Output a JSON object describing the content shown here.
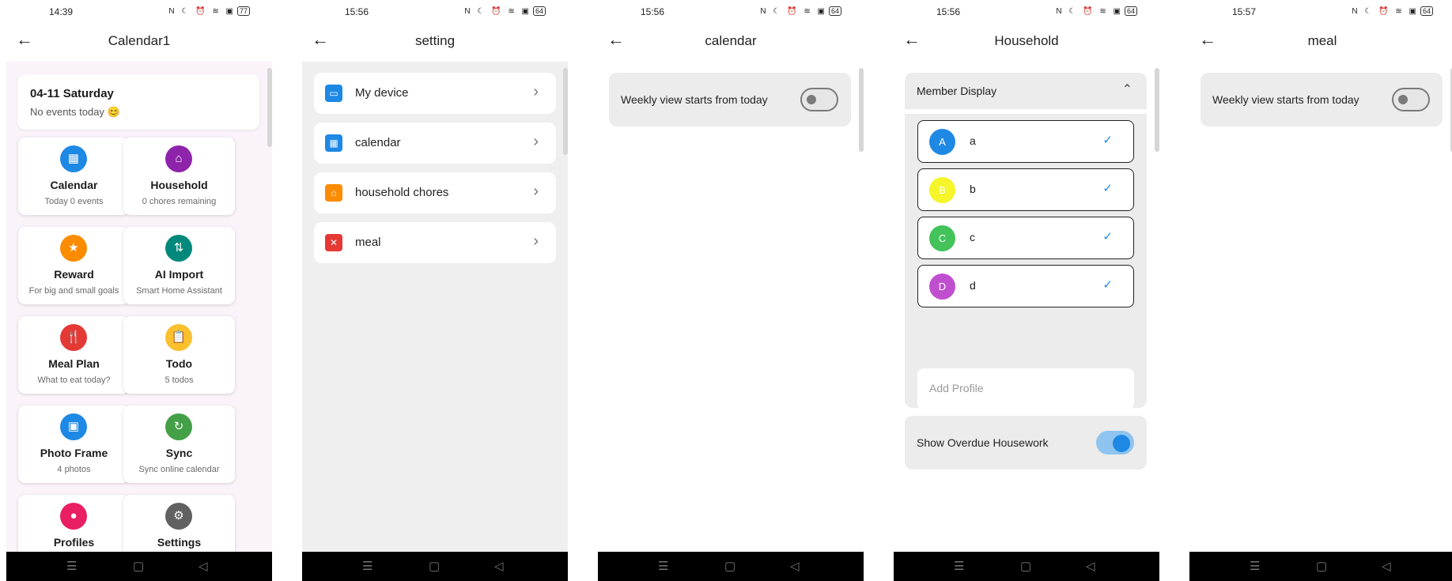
{
  "nav_glyphs": {
    "back": "←",
    "menu": "☰",
    "home": "▢",
    "back_tri": "◁",
    "chevron": "›",
    "collapse": "⌃",
    "check": "✓"
  },
  "screens": [
    {
      "status_time": "14:39",
      "status_icons": "N ☾ ⏰ ≋ ▣",
      "battery": "77",
      "title": "Calendar1",
      "today": {
        "date": "04-11 Saturday",
        "message": "No events today 😊"
      },
      "tiles": [
        {
          "name": "Calendar",
          "sub": "Today 0 events",
          "icon": "calendar-icon",
          "glyph": "▦",
          "color": "#1e88e5"
        },
        {
          "name": "Household",
          "sub": "0 chores remaining",
          "icon": "home-icon",
          "glyph": "⌂",
          "color": "#8e24aa"
        },
        {
          "name": "Reward",
          "sub": "For big and small goals",
          "icon": "star-icon",
          "glyph": "★",
          "color": "#fb8c00"
        },
        {
          "name": "AI Import",
          "sub": "Smart Home Assistant",
          "icon": "swap-icon",
          "glyph": "⇅",
          "color": "#00897b"
        },
        {
          "name": "Meal Plan",
          "sub": "What to eat today?",
          "icon": "cutlery-icon",
          "glyph": "🍴",
          "color": "#e53935"
        },
        {
          "name": "Todo",
          "sub": "5 todos",
          "icon": "clipboard-icon",
          "glyph": "📋",
          "color": "#fbc02d"
        },
        {
          "name": "Photo Frame",
          "sub": "4 photos",
          "icon": "photo-frame-icon",
          "glyph": "▣",
          "color": "#1e88e5"
        },
        {
          "name": "Sync",
          "sub": "Sync online calendar",
          "icon": "sync-icon",
          "glyph": "↻",
          "color": "#43a047"
        },
        {
          "name": "Profiles",
          "sub": "",
          "icon": "person-icon",
          "glyph": "●",
          "color": "#e91e63"
        },
        {
          "name": "Settings",
          "sub": "",
          "icon": "gear-icon",
          "glyph": "⚙",
          "color": "#616161"
        }
      ]
    },
    {
      "status_time": "15:56",
      "status_icons": "N ☾ ⏰ ≋ ▣",
      "battery": "64",
      "title": "setting",
      "rows": [
        {
          "label": "My device",
          "icon": "device-icon",
          "glyph": "▭",
          "color": "#1e88e5"
        },
        {
          "label": "calendar",
          "icon": "calendar-icon",
          "glyph": "▦",
          "color": "#1e88e5"
        },
        {
          "label": "household chores",
          "icon": "broom-icon",
          "glyph": "⌂",
          "color": "#fb8c00"
        },
        {
          "label": "meal",
          "icon": "cutlery-icon",
          "glyph": "✕",
          "color": "#e53935"
        }
      ]
    },
    {
      "status_time": "15:56",
      "status_icons": "N ☾ ⏰ ≋ ▣",
      "battery": "64",
      "title": "calendar",
      "toggle_label": "Weekly view starts from today",
      "toggle_on": false
    },
    {
      "status_time": "15:56",
      "status_icons": "N ☾ ⏰ ≋ ▣",
      "battery": "64",
      "title": "Household",
      "section_label": "Member Display",
      "members": [
        {
          "initial": "A",
          "name": "a",
          "color": "#1e88e5",
          "checked": true
        },
        {
          "initial": "B",
          "name": "b",
          "color": "#f5f52a",
          "checked": true
        },
        {
          "initial": "C",
          "name": "c",
          "color": "#43c35a",
          "checked": true
        },
        {
          "initial": "D",
          "name": "d",
          "color": "#c04fd0",
          "checked": true
        }
      ],
      "add_profile_placeholder": "Add Profile",
      "overdue_label": "Show Overdue Housework",
      "overdue_on": true
    },
    {
      "status_time": "15:57",
      "status_icons": "N ☾ ⏰ ≋ ▣",
      "battery": "64",
      "title": "meal",
      "toggle_label": "Weekly view starts from today",
      "toggle_on": false
    }
  ]
}
